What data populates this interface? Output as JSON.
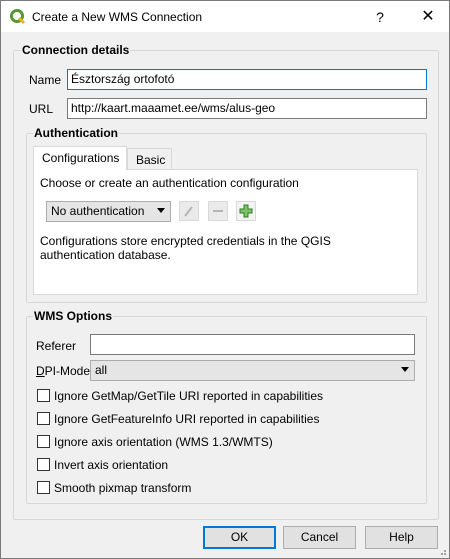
{
  "window": {
    "title": "Create a New WMS Connection",
    "help_glyph": "?",
    "close_glyph": "✕"
  },
  "connection": {
    "group_title": "Connection details",
    "name_label": "Name",
    "name_value": "Észtország ortofotó",
    "url_label": "URL",
    "url_value": "http://kaart.maaamet.ee/wms/alus-geo"
  },
  "authentication": {
    "group_title": "Authentication",
    "tabs": [
      {
        "label": "Configurations",
        "active": true
      },
      {
        "label": "Basic",
        "active": false
      }
    ],
    "prompt": "Choose or create an authentication configuration",
    "combo_value": "No authentication",
    "info_text": "Configurations store encrypted credentials in the QGIS authentication database."
  },
  "wms_options": {
    "group_title": "WMS Options",
    "referer_label": "Referer",
    "referer_value": "",
    "dpi_label_prefix": "D",
    "dpi_label_rest": "PI-Mode",
    "dpi_value": "all",
    "checkboxes": [
      {
        "label": "Ignore GetMap/GetTile URI reported in capabilities",
        "checked": false
      },
      {
        "label": "Ignore GetFeatureInfo URI reported in capabilities",
        "checked": false
      },
      {
        "label": "Ignore axis orientation (WMS 1.3/WMTS)",
        "checked": false
      },
      {
        "label": "Invert axis orientation",
        "checked": false
      },
      {
        "label": "Smooth pixmap transform",
        "checked": false
      }
    ]
  },
  "buttons": {
    "ok": "OK",
    "cancel": "Cancel",
    "help": "Help"
  },
  "colors": {
    "accent": "#0078d7",
    "icon_green": "#3a9e2c",
    "qgis_green": "#589632"
  }
}
